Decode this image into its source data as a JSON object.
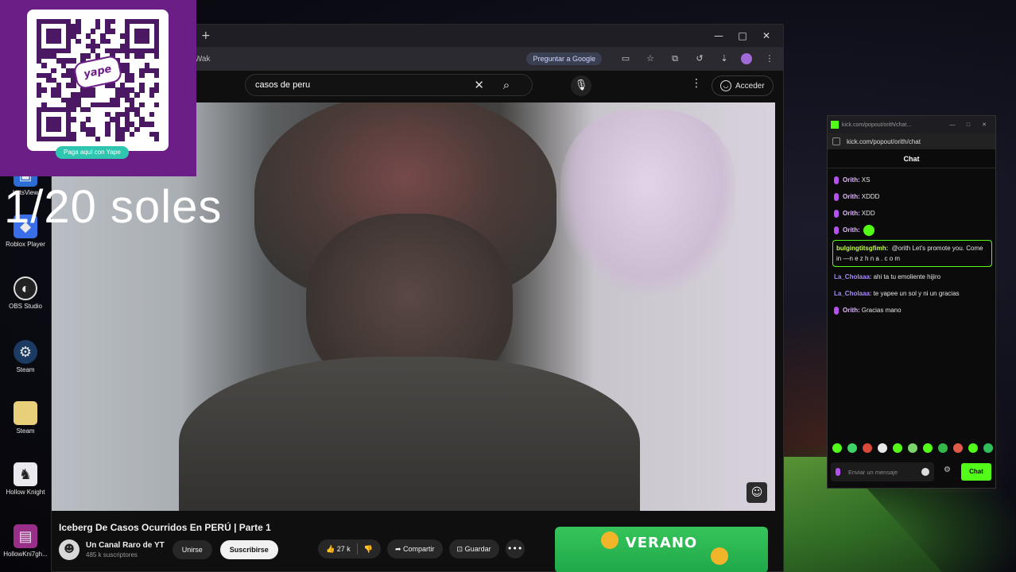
{
  "overlay": {
    "yape_logo": "yape",
    "yape_button": "Paga aquí con Yape",
    "soles_text": "1/20 soles"
  },
  "desktop": {
    "icons": [
      {
        "label": "LetsView",
        "icon": "letsview-icon"
      },
      {
        "label": "Roblox Player",
        "icon": "roblox-icon"
      },
      {
        "label": "OBS Studio",
        "icon": "obs-icon"
      },
      {
        "label": "Steam",
        "icon": "steam-icon"
      },
      {
        "label": "Steam",
        "icon": "folder-icon"
      },
      {
        "label": "Hollow Knight",
        "icon": "hollow-knight-icon"
      },
      {
        "label": "HollowKni7gh...",
        "icon": "archive-icon"
      }
    ]
  },
  "browser": {
    "url": "?v=xFs-imAfWak",
    "ask_google": "Preguntar a Google",
    "search_value": "casos de peru",
    "sign_in": "Acceder"
  },
  "video": {
    "title": "Iceberg De Casos Ocurridos En PERÚ | Parte 1",
    "channel": "Un Canal Raro de YT",
    "subscribers": "485 k suscriptores",
    "join": "Unirse",
    "subscribe": "Suscribirse",
    "likes": "27 k",
    "share": "Compartir",
    "save": "Guardar",
    "ad_text": "VERANO"
  },
  "kick": {
    "window_url": "kick.com/popout/orith/chat...",
    "address": "kick.com/popout/orith/chat",
    "header": "Chat",
    "messages": [
      {
        "user": "Orith:",
        "text": "XS"
      },
      {
        "user": "Orith:",
        "text": "XDDD"
      },
      {
        "user": "Orith:",
        "text": "XDD"
      },
      {
        "user": "Orith:",
        "text": ""
      },
      {
        "user": "bulgingtitsgfimh:",
        "text": "@orith Let's promote you. Come in —n e z h n a . c o m"
      },
      {
        "user": "La_Cholaaa:",
        "text": "ahi ta tu emoliente hijiro"
      },
      {
        "user": "La_Cholaaa:",
        "text": "te yapee un sol y ni un gracias"
      },
      {
        "user": "Orith:",
        "text": "Gracias mano"
      }
    ],
    "input_placeholder": "Enviar un mensaje",
    "send": "Chat",
    "accent": "#53fc18"
  }
}
